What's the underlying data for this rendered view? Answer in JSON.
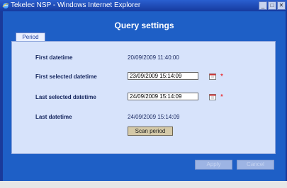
{
  "window": {
    "title": "Tekelec NSP - Windows Internet Explorer"
  },
  "dialog": {
    "title": "Query settings"
  },
  "tab": {
    "label": "Period"
  },
  "fields": {
    "first_datetime": {
      "label": "First datetime",
      "value": "20/09/2009 11:40:00"
    },
    "first_selected": {
      "label": "First selected datetime",
      "value": "23/09/2009 15:14:09"
    },
    "last_selected": {
      "label": "Last selected datetime",
      "value": "24/09/2009 15:14:09"
    },
    "last_datetime": {
      "label": "Last datetime",
      "value": "24/09/2009 15:14:09"
    }
  },
  "required_marker": "*",
  "buttons": {
    "scan": "Scan period",
    "apply": "Apply",
    "cancel": "Cancel"
  },
  "colors": {
    "client_bg": "#1e5fc6",
    "panel_bg": "#d7e3fb",
    "required": "#e00000"
  },
  "icons": [
    "ie-icon",
    "calendar-icon",
    "minimize-icon",
    "maximize-icon",
    "close-icon"
  ]
}
